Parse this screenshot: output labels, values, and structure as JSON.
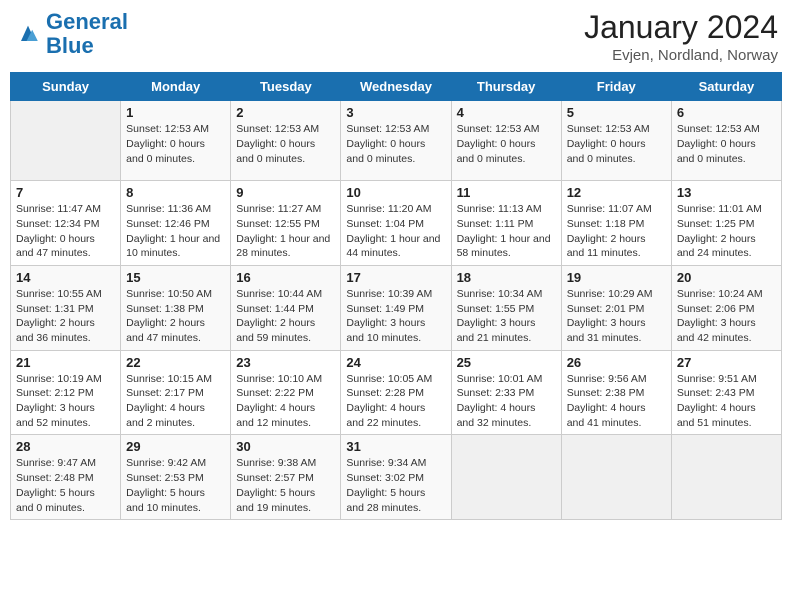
{
  "header": {
    "logo_general": "General",
    "logo_blue": "Blue",
    "title": "January 2024",
    "subtitle": "Evjen, Nordland, Norway"
  },
  "days_of_week": [
    "Sunday",
    "Monday",
    "Tuesday",
    "Wednesday",
    "Thursday",
    "Friday",
    "Saturday"
  ],
  "weeks": [
    [
      {
        "day": "",
        "info": ""
      },
      {
        "day": "1",
        "info": "Sunset: 12:53 AM\nDaylight: 0 hours\nand 0 minutes."
      },
      {
        "day": "2",
        "info": "Sunset: 12:53 AM\nDaylight: 0 hours\nand 0 minutes."
      },
      {
        "day": "3",
        "info": "Sunset: 12:53 AM\nDaylight: 0 hours\nand 0 minutes."
      },
      {
        "day": "4",
        "info": "Sunset: 12:53 AM\nDaylight: 0 hours\nand 0 minutes."
      },
      {
        "day": "5",
        "info": "Sunset: 12:53 AM\nDaylight: 0 hours\nand 0 minutes."
      },
      {
        "day": "6",
        "info": "Sunset: 12:53 AM\nDaylight: 0 hours\nand 0 minutes."
      }
    ],
    [
      {
        "day": "7",
        "info": "Sunrise: 11:47 AM\nSunset: 12:34 PM\nDaylight: 0 hours\nand 47 minutes."
      },
      {
        "day": "8",
        "info": "Sunrise: 11:36 AM\nSunset: 12:46 PM\nDaylight: 1 hour and\n10 minutes."
      },
      {
        "day": "9",
        "info": "Sunrise: 11:27 AM\nSunset: 12:55 PM\nDaylight: 1 hour and\n28 minutes."
      },
      {
        "day": "10",
        "info": "Sunrise: 11:20 AM\nSunset: 1:04 PM\nDaylight: 1 hour and\n44 minutes."
      },
      {
        "day": "11",
        "info": "Sunrise: 11:13 AM\nSunset: 1:11 PM\nDaylight: 1 hour and\n58 minutes."
      },
      {
        "day": "12",
        "info": "Sunrise: 11:07 AM\nSunset: 1:18 PM\nDaylight: 2 hours\nand 11 minutes."
      },
      {
        "day": "13",
        "info": "Sunrise: 11:01 AM\nSunset: 1:25 PM\nDaylight: 2 hours\nand 24 minutes."
      }
    ],
    [
      {
        "day": "14",
        "info": "Sunrise: 10:55 AM\nSunset: 1:31 PM\nDaylight: 2 hours\nand 36 minutes."
      },
      {
        "day": "15",
        "info": "Sunrise: 10:50 AM\nSunset: 1:38 PM\nDaylight: 2 hours\nand 47 minutes."
      },
      {
        "day": "16",
        "info": "Sunrise: 10:44 AM\nSunset: 1:44 PM\nDaylight: 2 hours\nand 59 minutes."
      },
      {
        "day": "17",
        "info": "Sunrise: 10:39 AM\nSunset: 1:49 PM\nDaylight: 3 hours\nand 10 minutes."
      },
      {
        "day": "18",
        "info": "Sunrise: 10:34 AM\nSunset: 1:55 PM\nDaylight: 3 hours\nand 21 minutes."
      },
      {
        "day": "19",
        "info": "Sunrise: 10:29 AM\nSunset: 2:01 PM\nDaylight: 3 hours\nand 31 minutes."
      },
      {
        "day": "20",
        "info": "Sunrise: 10:24 AM\nSunset: 2:06 PM\nDaylight: 3 hours\nand 42 minutes."
      }
    ],
    [
      {
        "day": "21",
        "info": "Sunrise: 10:19 AM\nSunset: 2:12 PM\nDaylight: 3 hours\nand 52 minutes."
      },
      {
        "day": "22",
        "info": "Sunrise: 10:15 AM\nSunset: 2:17 PM\nDaylight: 4 hours\nand 2 minutes."
      },
      {
        "day": "23",
        "info": "Sunrise: 10:10 AM\nSunset: 2:22 PM\nDaylight: 4 hours\nand 12 minutes."
      },
      {
        "day": "24",
        "info": "Sunrise: 10:05 AM\nSunset: 2:28 PM\nDaylight: 4 hours\nand 22 minutes."
      },
      {
        "day": "25",
        "info": "Sunrise: 10:01 AM\nSunset: 2:33 PM\nDaylight: 4 hours\nand 32 minutes."
      },
      {
        "day": "26",
        "info": "Sunrise: 9:56 AM\nSunset: 2:38 PM\nDaylight: 4 hours\nand 41 minutes."
      },
      {
        "day": "27",
        "info": "Sunrise: 9:51 AM\nSunset: 2:43 PM\nDaylight: 4 hours\nand 51 minutes."
      }
    ],
    [
      {
        "day": "28",
        "info": "Sunrise: 9:47 AM\nSunset: 2:48 PM\nDaylight: 5 hours\nand 0 minutes."
      },
      {
        "day": "29",
        "info": "Sunrise: 9:42 AM\nSunset: 2:53 PM\nDaylight: 5 hours\nand 10 minutes."
      },
      {
        "day": "30",
        "info": "Sunrise: 9:38 AM\nSunset: 2:57 PM\nDaylight: 5 hours\nand 19 minutes."
      },
      {
        "day": "31",
        "info": "Sunrise: 9:34 AM\nSunset: 3:02 PM\nDaylight: 5 hours\nand 28 minutes."
      },
      {
        "day": "",
        "info": ""
      },
      {
        "day": "",
        "info": ""
      },
      {
        "day": "",
        "info": ""
      }
    ]
  ]
}
